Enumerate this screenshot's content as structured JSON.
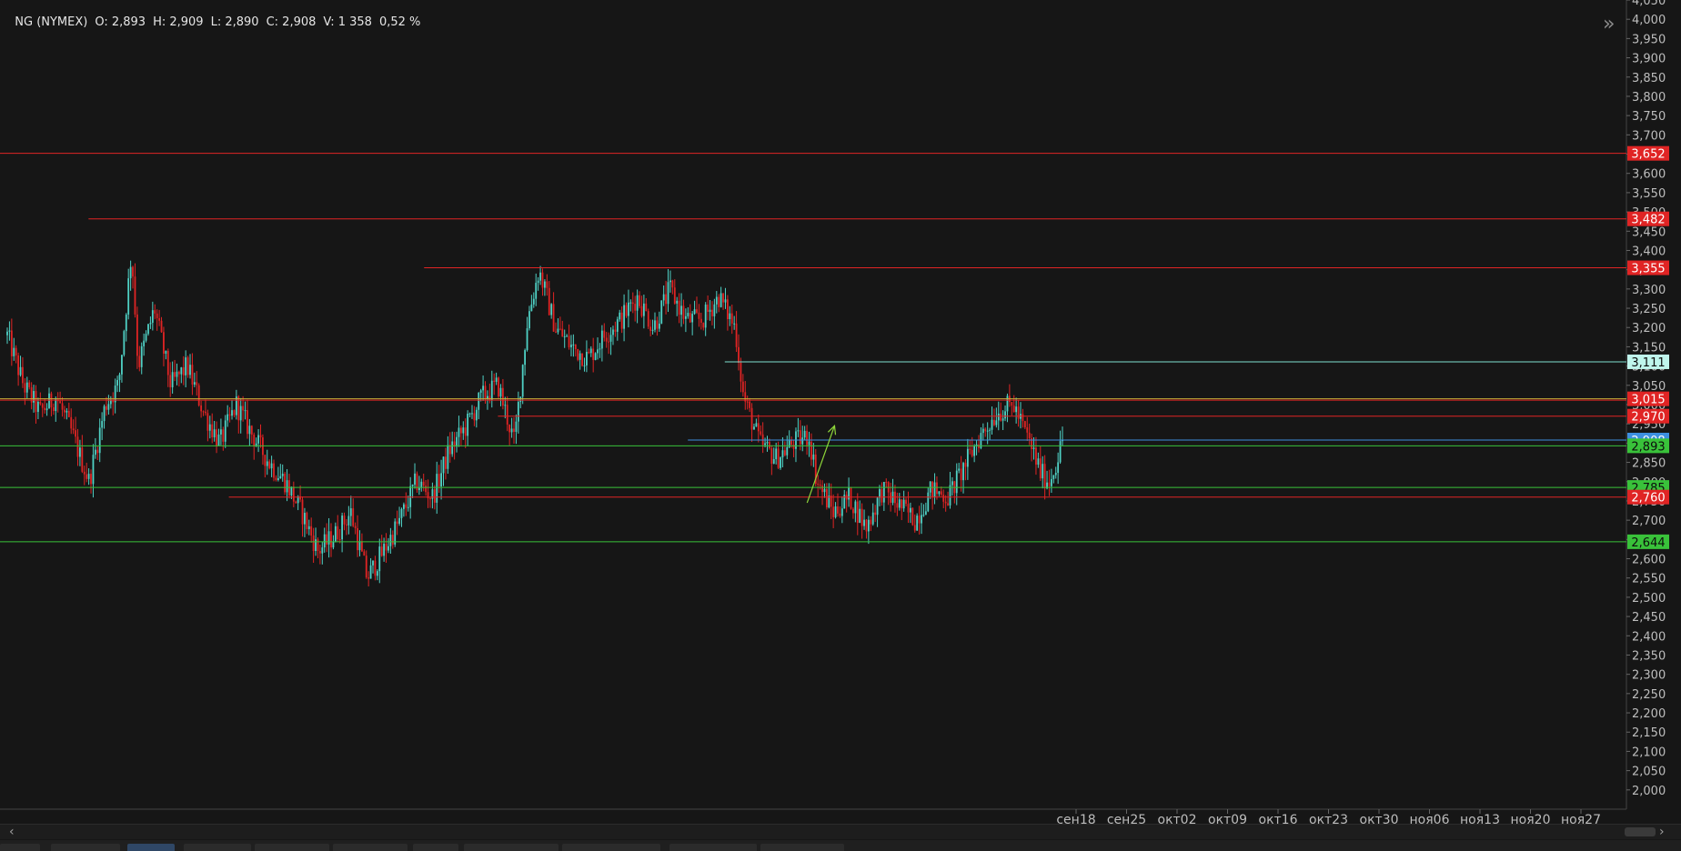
{
  "header": {
    "symbol": "NG (NYMEX)",
    "open": "O: 2,893",
    "high": "H: 2,909",
    "low": "L: 2,890",
    "close": "C: 2,908",
    "volume": "V: 1 358",
    "change": "0,52 %"
  },
  "colors": {
    "background": "#161616",
    "up_candle": "#4fd1c5",
    "down_candle": "#e02424",
    "resistance": "#e02424",
    "support": "#39c23a",
    "target": "#7fe0d0",
    "current": "#3d8fe0",
    "trend_arrow": "#8ed63a"
  },
  "icons": {
    "collapse": "double-chevron-right-icon",
    "scroll_left": "chevron-left-icon",
    "scroll_right": "chevron-right-icon"
  },
  "chart_data": {
    "type": "candlestick",
    "y_axis": {
      "ylim": [
        1.95,
        4.05
      ],
      "ticks": [
        "4,050",
        "4,000",
        "3,950",
        "3,900",
        "3,850",
        "3,800",
        "3,750",
        "3,700",
        "3,650",
        "3,600",
        "3,550",
        "3,500",
        "3,450",
        "3,400",
        "3,350",
        "3,300",
        "3,250",
        "3,200",
        "3,150",
        "3,100",
        "3,050",
        "3,000",
        "2,950",
        "2,900",
        "2,850",
        "2,800",
        "2,750",
        "2,700",
        "2,650",
        "2,600",
        "2,550",
        "2,500",
        "2,450",
        "2,400",
        "2,350",
        "2,300",
        "2,250",
        "2,200",
        "2,150",
        "2,100",
        "2,050",
        "2,000"
      ]
    },
    "x_axis": {
      "ticks": [
        "сен18",
        "сен25",
        "окт02",
        "окт09",
        "окт16",
        "окт23",
        "окт30",
        "ноя06",
        "ноя13",
        "ноя20",
        "ноя27"
      ]
    },
    "levels": [
      {
        "label": "3,652",
        "value": 3.652,
        "kind": "resistance",
        "full": true
      },
      {
        "label": "3,482",
        "value": 3.482,
        "kind": "resistance",
        "from_index": 0.077
      },
      {
        "label": "3,355",
        "value": 3.355,
        "kind": "resistance",
        "from_index": 0.395
      },
      {
        "label": "3,111",
        "value": 3.111,
        "kind": "target",
        "from_index": 0.68
      },
      {
        "label": "3,015",
        "value": 3.015,
        "kind": "resistance",
        "full": true,
        "yellow": true
      },
      {
        "label": "2,970",
        "value": 2.97,
        "kind": "resistance",
        "from_index": 0.465
      },
      {
        "label": "2,908",
        "value": 2.908,
        "kind": "current",
        "from_index": 0.645
      },
      {
        "label": "2,893",
        "value": 2.893,
        "kind": "support",
        "full": true
      },
      {
        "label": "2,785",
        "value": 2.785,
        "kind": "support",
        "full": true
      },
      {
        "label": "2,760",
        "value": 2.76,
        "kind": "resistance",
        "from_index": 0.21
      },
      {
        "label": "2,644",
        "value": 2.644,
        "kind": "support",
        "full": true
      }
    ],
    "price_path": [
      [
        0.0,
        3.18
      ],
      [
        0.01,
        3.05
      ],
      [
        0.02,
        2.98
      ],
      [
        0.03,
        3.02
      ],
      [
        0.04,
        2.92
      ],
      [
        0.05,
        2.8
      ],
      [
        0.06,
        3.0
      ],
      [
        0.068,
        3.05
      ],
      [
        0.076,
        3.4
      ],
      [
        0.08,
        3.1
      ],
      [
        0.09,
        3.25
      ],
      [
        0.1,
        3.05
      ],
      [
        0.11,
        3.1
      ],
      [
        0.12,
        2.98
      ],
      [
        0.13,
        2.9
      ],
      [
        0.14,
        3.0
      ],
      [
        0.15,
        2.92
      ],
      [
        0.16,
        2.85
      ],
      [
        0.17,
        2.8
      ],
      [
        0.18,
        2.72
      ],
      [
        0.19,
        2.62
      ],
      [
        0.2,
        2.66
      ],
      [
        0.21,
        2.72
      ],
      [
        0.22,
        2.55
      ],
      [
        0.23,
        2.62
      ],
      [
        0.24,
        2.7
      ],
      [
        0.25,
        2.8
      ],
      [
        0.26,
        2.76
      ],
      [
        0.27,
        2.88
      ],
      [
        0.28,
        2.94
      ],
      [
        0.29,
        3.02
      ],
      [
        0.3,
        3.05
      ],
      [
        0.31,
        2.9
      ],
      [
        0.318,
        3.22
      ],
      [
        0.325,
        3.35
      ],
      [
        0.335,
        3.2
      ],
      [
        0.345,
        3.15
      ],
      [
        0.355,
        3.12
      ],
      [
        0.365,
        3.18
      ],
      [
        0.375,
        3.22
      ],
      [
        0.385,
        3.28
      ],
      [
        0.395,
        3.2
      ],
      [
        0.405,
        3.3
      ],
      [
        0.415,
        3.22
      ],
      [
        0.425,
        3.22
      ],
      [
        0.435,
        3.28
      ],
      [
        0.445,
        3.2
      ],
      [
        0.45,
        3.02
      ],
      [
        0.46,
        2.9
      ],
      [
        0.47,
        2.86
      ],
      [
        0.48,
        2.9
      ],
      [
        0.49,
        2.92
      ],
      [
        0.495,
        2.8
      ],
      [
        0.505,
        2.72
      ],
      [
        0.515,
        2.76
      ],
      [
        0.525,
        2.68
      ],
      [
        0.535,
        2.78
      ],
      [
        0.545,
        2.74
      ],
      [
        0.555,
        2.7
      ],
      [
        0.565,
        2.78
      ],
      [
        0.575,
        2.76
      ],
      [
        0.585,
        2.84
      ],
      [
        0.595,
        2.92
      ],
      [
        0.605,
        2.98
      ],
      [
        0.615,
        3.0
      ],
      [
        0.625,
        2.9
      ],
      [
        0.632,
        2.82
      ],
      [
        0.637,
        2.8
      ],
      [
        0.642,
        2.86
      ],
      [
        0.645,
        2.908
      ]
    ],
    "trend_arrow": {
      "from": [
        0.758,
        2.745
      ],
      "to": [
        0.784,
        2.945
      ]
    }
  }
}
